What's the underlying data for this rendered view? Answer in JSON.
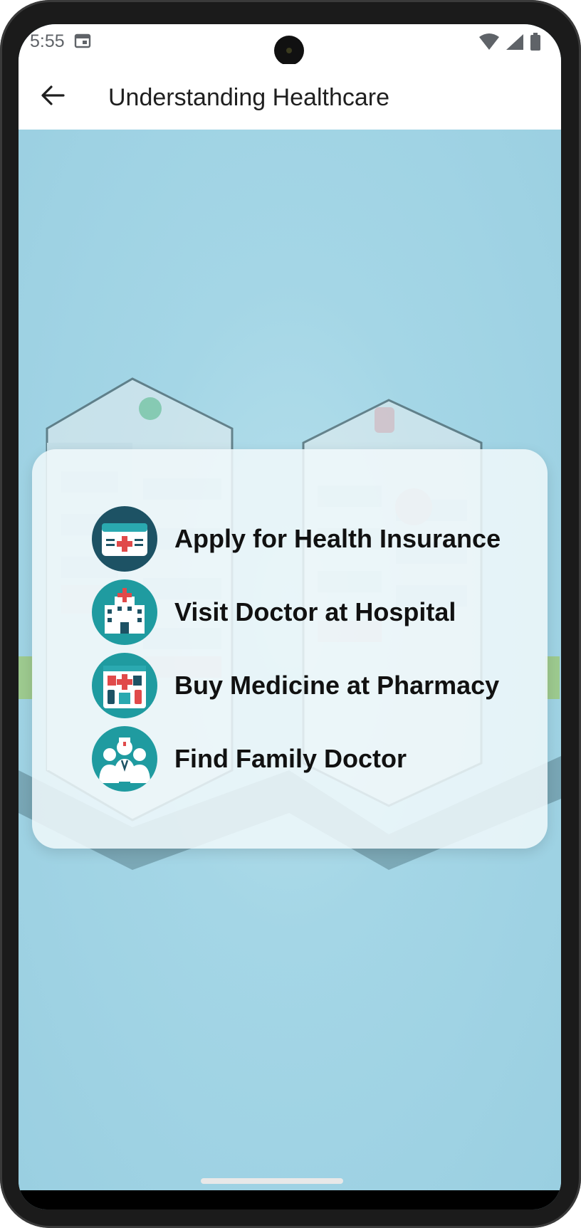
{
  "status": {
    "time": "5:55",
    "icons": [
      "calendar-icon",
      "wifi-icon",
      "signal-icon",
      "battery-icon"
    ]
  },
  "appbar": {
    "back_icon": "arrow-left-icon",
    "title": "Understanding Healthcare"
  },
  "menu": {
    "items": [
      {
        "label": "Apply for Health Insurance",
        "icon": "insurance-card-icon"
      },
      {
        "label": "Visit Doctor at Hospital",
        "icon": "hospital-icon"
      },
      {
        "label": "Buy Medicine at Pharmacy",
        "icon": "pharmacy-icon"
      },
      {
        "label": "Find Family Doctor",
        "icon": "doctors-icon"
      }
    ]
  },
  "colors": {
    "background": "#9fd3e3",
    "icon_teal": "#1f9ba0",
    "icon_dark": "#1d5264",
    "accent_red": "#e04a4a"
  }
}
